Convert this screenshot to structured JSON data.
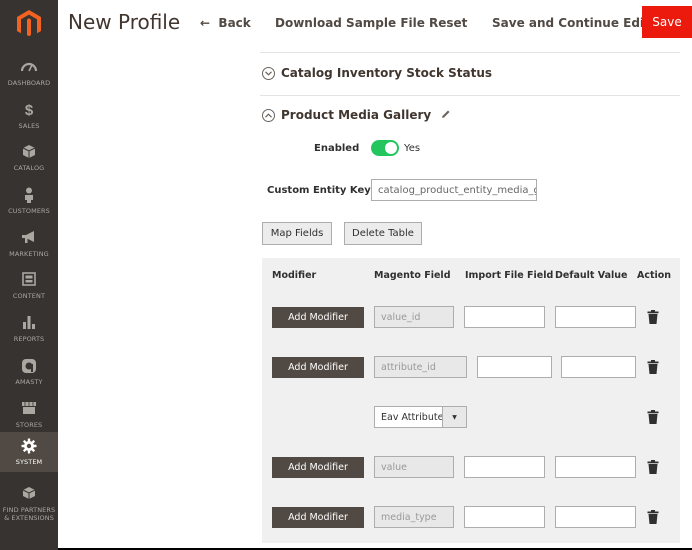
{
  "sidebar": {
    "items": [
      {
        "label": "DASHBOARD",
        "icon": "dashboard-icon"
      },
      {
        "label": "SALES",
        "icon": "dollar-icon"
      },
      {
        "label": "CATALOG",
        "icon": "cube-icon"
      },
      {
        "label": "CUSTOMERS",
        "icon": "person-icon"
      },
      {
        "label": "MARKETING",
        "icon": "megaphone-icon"
      },
      {
        "label": "CONTENT",
        "icon": "layout-icon"
      },
      {
        "label": "REPORTS",
        "icon": "bar-chart-icon"
      },
      {
        "label": "AMASTY",
        "icon": "amasty-icon"
      },
      {
        "label": "STORES",
        "icon": "storefront-icon"
      },
      {
        "label": "SYSTEM",
        "icon": "gear-icon"
      },
      {
        "label": "FIND PARTNERS",
        "label2": "& EXTENSIONS",
        "icon": "box-icon"
      }
    ],
    "active": "SYSTEM"
  },
  "header": {
    "title": "New Profile",
    "back": "Back",
    "download": "Download Sample File",
    "reset": "Reset",
    "save_continue": "Save and Continue Edit",
    "save": "Save"
  },
  "sections": {
    "stock_status": "Catalog Inventory Stock Status",
    "media_gallery": "Product Media Gallery"
  },
  "form": {
    "enabled_label": "Enabled",
    "enabled_value": "Yes",
    "entity_key_label": "Custom Entity Key",
    "entity_key_value": "catalog_product_entity_media_gal",
    "map_fields": "Map Fields",
    "delete_table": "Delete Table"
  },
  "table": {
    "headers": [
      "Modifier",
      "Magento Field",
      "Import File Field",
      "Default Value",
      "Action"
    ],
    "add_modifier_label": "Add Modifier",
    "rows": [
      {
        "field": "value_id"
      },
      {
        "field": "attribute_id"
      },
      {
        "select": "Eav Attribute Option"
      },
      {
        "field": "value"
      },
      {
        "field": "media_type"
      }
    ]
  },
  "colors": {
    "sidebar_bg": "#373330",
    "active_bg": "#514943",
    "save_bg": "#eb1a0d",
    "toggle_on": "#22c55e"
  }
}
